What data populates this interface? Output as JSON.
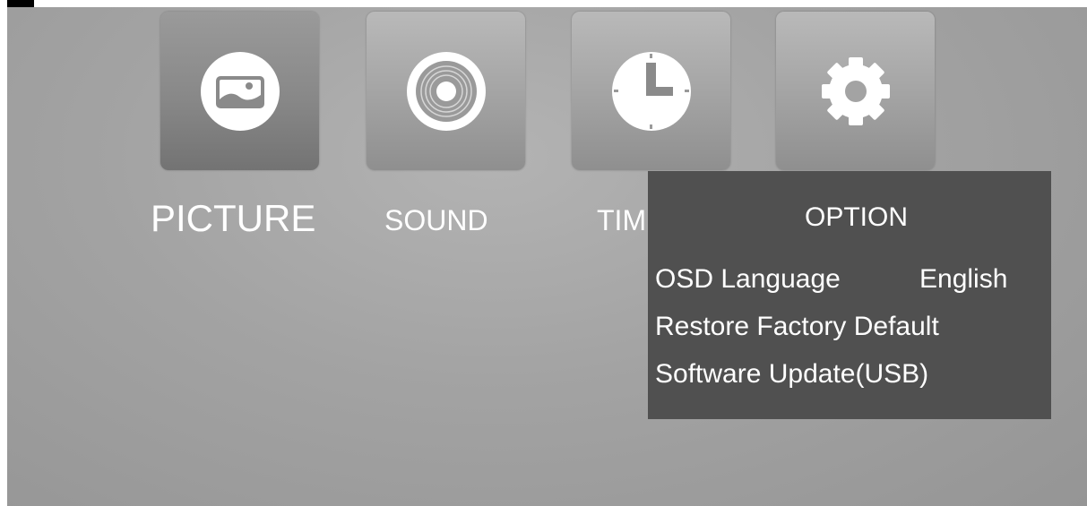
{
  "menu": {
    "tabs": [
      {
        "label": "PICTURE",
        "icon": "picture-icon"
      },
      {
        "label": "SOUND",
        "icon": "sound-icon"
      },
      {
        "label": "TIM",
        "icon": "clock-icon"
      },
      {
        "label": "",
        "icon": "gear-icon"
      }
    ]
  },
  "option_panel": {
    "title": "OPTION",
    "items": [
      {
        "label": "OSD Language",
        "value": "English"
      },
      {
        "label": "Restore Factory Default"
      },
      {
        "label": "Software Update(USB)"
      }
    ]
  }
}
